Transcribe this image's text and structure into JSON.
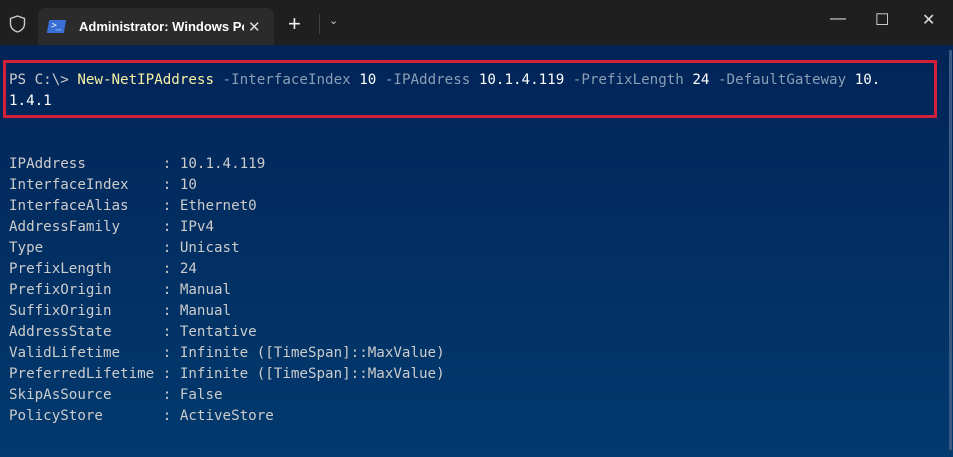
{
  "window": {
    "tab_title": "Administrator: Windows Powe",
    "close_tab": "✕",
    "new_tab": "+",
    "dropdown": "⌄",
    "minimize": "—",
    "maximize": "☐",
    "close": "✕",
    "ps_icon": ">_"
  },
  "command": {
    "prompt": "PS C:\\> ",
    "cmdlet": "New-NetIPAddress",
    "p1": " -InterfaceIndex ",
    "v1": "10",
    "p2": " -IPAddress ",
    "v2": "10.1.4.119",
    "p3": " -PrefixLength ",
    "v3": "24",
    "p4": " -DefaultGateway ",
    "v4a": "10.",
    "v4b": "1.4.1"
  },
  "output": [
    "IPAddress         : 10.1.4.119",
    "InterfaceIndex    : 10",
    "InterfaceAlias    : Ethernet0",
    "AddressFamily     : IPv4",
    "Type              : Unicast",
    "PrefixLength      : 24",
    "PrefixOrigin      : Manual",
    "SuffixOrigin      : Manual",
    "AddressState      : Tentative",
    "ValidLifetime     : Infinite ([TimeSpan]::MaxValue)",
    "PreferredLifetime : Infinite ([TimeSpan]::MaxValue)",
    "SkipAsSource      : False",
    "PolicyStore       : ActiveStore"
  ]
}
